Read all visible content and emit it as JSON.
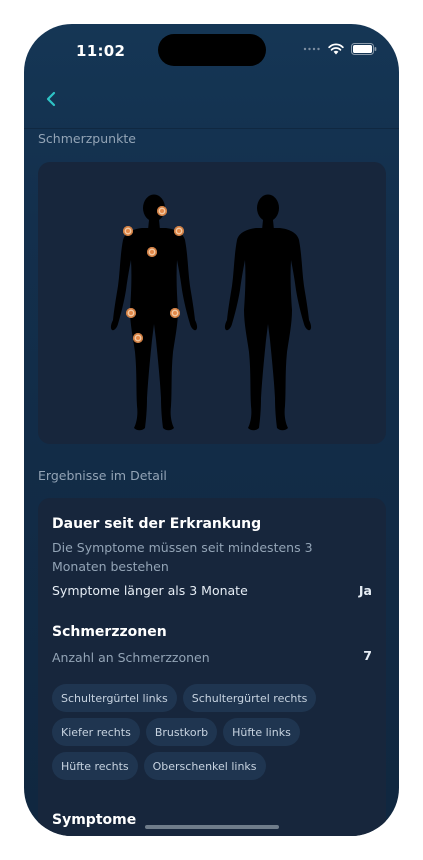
{
  "status_bar": {
    "time": "11:02"
  },
  "sections": {
    "pain_points": "Schmerzpunkte",
    "results": "Ergebnisse im Detail"
  },
  "duration": {
    "title": "Dauer seit der Erkrankung",
    "description": "Die Symptome müssen seit mindestens 3 Monaten bestehen",
    "row_label": "Symptome länger als 3 Monate",
    "row_value": "Ja"
  },
  "zones": {
    "title": "Schmerzzonen",
    "row_label": "Anzahl an Schmerzzonen",
    "row_value": "7",
    "chips": [
      "Schultergürtel links",
      "Schultergürtel rechts",
      "Kiefer rechts",
      "Brustkorb",
      "Hüfte links",
      "Hüfte rechts",
      "Oberschenkel links"
    ]
  },
  "symptoms": {
    "title": "Symptome"
  },
  "colors": {
    "accent": "#2ec4c6",
    "background": "#132f4c",
    "card": "#17263c",
    "pain_dot": "#e3894a"
  },
  "icons": [
    "back-chevron-icon",
    "signal-icon",
    "wifi-icon",
    "battery-icon"
  ]
}
